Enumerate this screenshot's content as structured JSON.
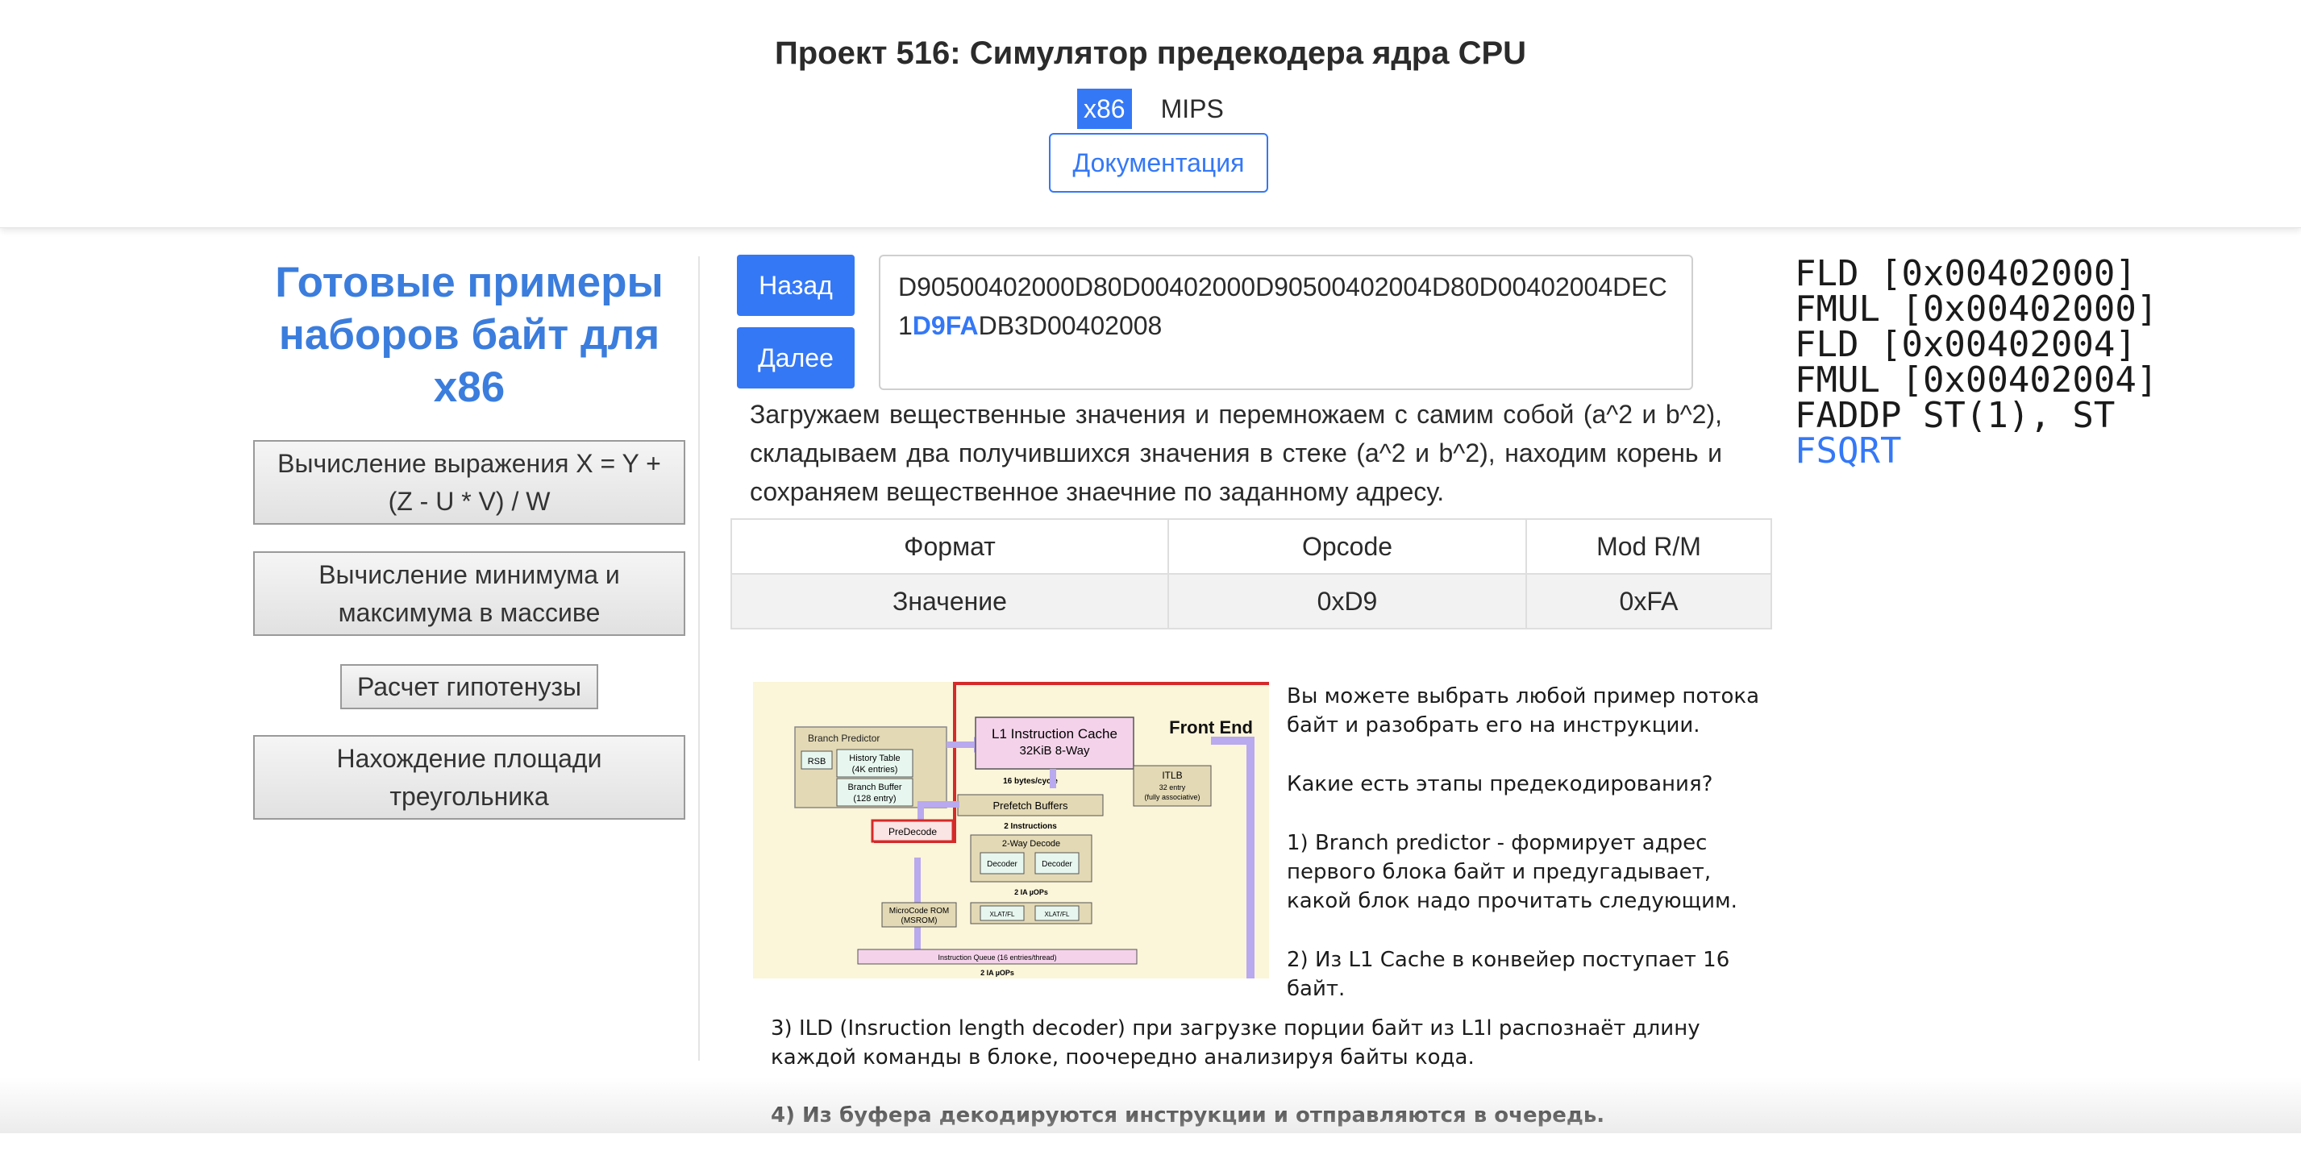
{
  "header": {
    "title": "Проект 516: Симулятор предекодера ядра CPU",
    "arch_tabs": [
      {
        "label": "x86",
        "active": true
      },
      {
        "label": "MIPS",
        "active": false
      }
    ],
    "docs_button": "Документация"
  },
  "examples": {
    "title": "Готовые примеры наборов байт для x86",
    "items": [
      {
        "label": "Вычисление выражения X = Y + (Z - U * V) / W"
      },
      {
        "label": "Вычисление минимума и максимума в массиве"
      },
      {
        "label": "Расчет гипотенузы"
      },
      {
        "label": "Нахождение площади треугольника"
      }
    ]
  },
  "nav": {
    "back_label": "Назад",
    "next_label": "Далее"
  },
  "bytes": {
    "before": "D90500402000D80D00402000D90500402004D80D00402004DEC1",
    "highlight": "D9FA",
    "after": "DB3D00402008"
  },
  "description": "Загружаем вещественные значения и перемножаем с самим собой (a^2 и b^2), складываем два получившихся значения в стеке (a^2 и b^2), находим корень и сохраняем вещественное знаечние по заданному адресу.",
  "format_table": {
    "headers": [
      "Формат",
      "Opcode",
      "Mod R/M"
    ],
    "values": [
      "Значение",
      "0xD9",
      "0xFA"
    ]
  },
  "diagram": {
    "front_end": "Front End",
    "branch_predictor": "Branch Predictor",
    "rsb": "RSB",
    "history_table": [
      "History Table",
      "(4K entries)"
    ],
    "branch_buffer": [
      "Branch Buffer",
      "(128 entry)"
    ],
    "l1_cache": [
      "L1 Instruction Cache",
      "32KiB 8-Way"
    ],
    "bytes_per_cycle": "16 bytes/cycle",
    "itlb": [
      "ITLB",
      "32 entry",
      "(fully associative)"
    ],
    "prefetch_buffers": "Prefetch Buffers",
    "two_instructions": "2 Instructions",
    "predecode": "PreDecode",
    "two_way_decode": "2-Way Decode",
    "decoder": "Decoder",
    "ia_uops": "2 IA µOPs",
    "microcode_rom": [
      "MicroCode ROM",
      "(MSROM)"
    ],
    "xlat": "XLAT/FL",
    "instruction_queue": "Instruction Queue (16 entries/thread)"
  },
  "right_text": [
    "Вы можете выбрать любой пример потока байт и разобрать его на инструкции.",
    "Какие есть этапы предекодирования?",
    "1) Branch predictor - формирует адрес первого блока байт и предугадывает, какой блок надо прочитать следующим.",
    "2) Из L1 Cache в конвейер поступает 16 байт."
  ],
  "bottom_text": [
    "3) ILD (Insruction length decoder) при загрузке порции байт из L1l распознаёт длину каждой команды в блоке, поочередно анализируя байты кода.",
    "4) Из буфера декодируются инструкции и отправляются в очередь."
  ],
  "assembly": [
    {
      "text": "FLD [0x00402000]",
      "current": false
    },
    {
      "text": "FMUL [0x00402000]",
      "current": false
    },
    {
      "text": "FLD [0x00402004]",
      "current": false
    },
    {
      "text": "FMUL [0x00402004]",
      "current": false
    },
    {
      "text": "FADDP ST(1), ST",
      "current": false
    },
    {
      "text": "FSQRT",
      "current": true
    }
  ],
  "colors": {
    "accent": "#3478f6",
    "heading": "#3b7ddd",
    "highlight_box": "#d42a2a"
  }
}
